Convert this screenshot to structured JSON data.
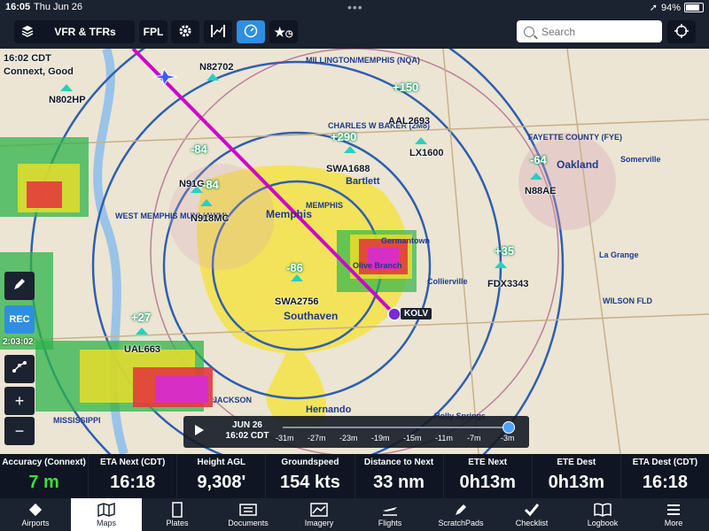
{
  "status": {
    "time": "16:05",
    "date": "Thu Jun 26",
    "battery": "94%",
    "battery_level": 0.94
  },
  "toolbar": {
    "layer_label": "VFR & TFRs",
    "fpl_label": "FPL",
    "search_placeholder": "Search"
  },
  "map": {
    "header_time": "16:02 CDT",
    "header_source": "Connext, Good",
    "labels": [
      "MILLINGTON/MEMPHIS (NQA)",
      "CHARLES W BAKER (2M8)",
      "FAYETTE COUNTY (FYE)",
      "Oakland",
      "Somerville",
      "Bartlett",
      "Memphis",
      "Southaven",
      "Hernando",
      "MEMPHIS",
      "JACKSON",
      "Collierville",
      "Germantown",
      "WEST MEMPHIS MUNI (AWM)",
      "MISSISSIPPI",
      "WILSON FLD",
      "La Grange",
      "Olive Branch",
      "Holly Springs"
    ],
    "aircraft": [
      "N802HP",
      "N82702",
      "AAL2693",
      "LX1600",
      "SWA1688",
      "N91G",
      "N918MC",
      "N88AE",
      "FDX3343",
      "SWA2756",
      "UAL663"
    ],
    "altitudes": [
      "+150",
      "+290",
      "-84",
      "-84",
      "-64",
      "+35",
      "-86",
      "+27"
    ],
    "destination": "KOLV",
    "rec_label": "REC",
    "rec_time": "2:03:02"
  },
  "timeline": {
    "date": "JUN 26",
    "time": "16:02 CDT",
    "ticks": [
      "-31m",
      "-27m",
      "-23m",
      "-19m",
      "-15m",
      "-11m",
      "-7m",
      "-3m"
    ]
  },
  "instruments": [
    {
      "label": "Accuracy (Connext)",
      "value": "7 m",
      "green": true
    },
    {
      "label": "ETA Next (CDT)",
      "value": "16:18"
    },
    {
      "label": "Height AGL",
      "value": "9,308'"
    },
    {
      "label": "Groundspeed",
      "value": "154 kts"
    },
    {
      "label": "Distance to Next",
      "value": "33 nm"
    },
    {
      "label": "ETE Next",
      "value": "0h13m"
    },
    {
      "label": "ETE Dest",
      "value": "0h13m"
    },
    {
      "label": "ETA Dest (CDT)",
      "value": "16:18"
    }
  ],
  "tabs": [
    {
      "label": "Airports",
      "icon": "airports-icon"
    },
    {
      "label": "Maps",
      "icon": "maps-icon",
      "active": true
    },
    {
      "label": "Plates",
      "icon": "plates-icon"
    },
    {
      "label": "Documents",
      "icon": "documents-icon"
    },
    {
      "label": "Imagery",
      "icon": "imagery-icon"
    },
    {
      "label": "Flights",
      "icon": "flights-icon"
    },
    {
      "label": "ScratchPads",
      "icon": "scratchpads-icon"
    },
    {
      "label": "Checklist",
      "icon": "checklist-icon"
    },
    {
      "label": "Logbook",
      "icon": "logbook-icon"
    },
    {
      "label": "More",
      "icon": "more-icon"
    }
  ],
  "colors": {
    "accent": "#2e8fe0",
    "ownship": "#3a5bff",
    "route": "#cc00cc",
    "green_value": "#3dde3d"
  }
}
